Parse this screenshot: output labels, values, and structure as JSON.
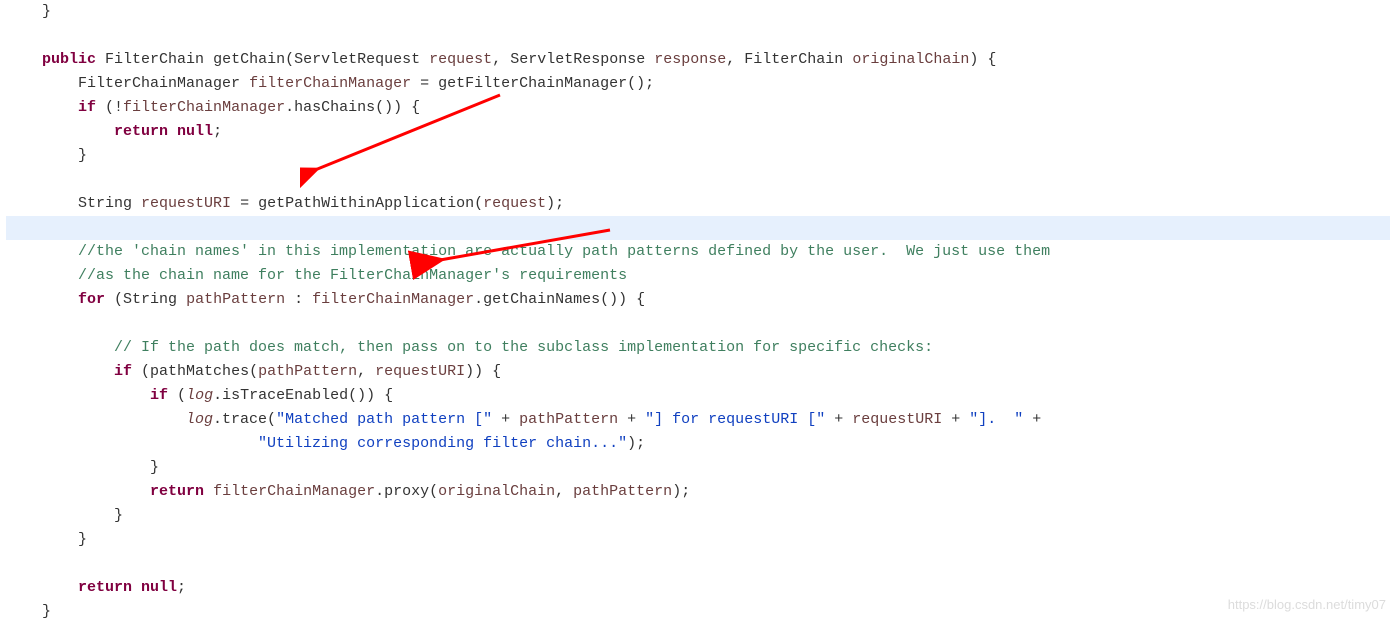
{
  "watermark": "https://blog.csdn.net/timy07",
  "colors": {
    "keyword": "#800040",
    "comment": "#3f7f5f",
    "string": "#1040c0",
    "variable": "#6a3e3e",
    "highlight": "#e6f0fd",
    "arrow": "#ff0000"
  },
  "arrows": [
    {
      "from_approx": "right-of getFilterChainManager() line",
      "to_approx": "requestURI token"
    },
    {
      "from_approx": "right end of first comment line",
      "to_approx": "FilterChainManager word in second comment"
    }
  ],
  "code": {
    "lines": [
      {
        "n": 0,
        "raw": "}"
      },
      {
        "n": 1,
        "raw": ""
      },
      {
        "n": 2,
        "raw": "public FilterChain getChain(ServletRequest request, ServletResponse response, FilterChain originalChain) {"
      },
      {
        "n": 3,
        "raw": "    FilterChainManager filterChainManager = getFilterChainManager();"
      },
      {
        "n": 4,
        "raw": "    if (!filterChainManager.hasChains()) {"
      },
      {
        "n": 5,
        "raw": "        return null;"
      },
      {
        "n": 6,
        "raw": "    }"
      },
      {
        "n": 7,
        "raw": ""
      },
      {
        "n": 8,
        "raw": "    String requestURI = getPathWithinApplication(request);",
        "highlighted_next_blank": true
      },
      {
        "n": 9,
        "raw": "",
        "highlighted": true
      },
      {
        "n": 10,
        "raw": "    //the 'chain names' in this implementation are actually path patterns defined by the user.  We just use them"
      },
      {
        "n": 11,
        "raw": "    //as the chain name for the FilterChainManager's requirements"
      },
      {
        "n": 12,
        "raw": "    for (String pathPattern : filterChainManager.getChainNames()) {"
      },
      {
        "n": 13,
        "raw": ""
      },
      {
        "n": 14,
        "raw": "        // If the path does match, then pass on to the subclass implementation for specific checks:"
      },
      {
        "n": 15,
        "raw": "        if (pathMatches(pathPattern, requestURI)) {"
      },
      {
        "n": 16,
        "raw": "            if (log.isTraceEnabled()) {"
      },
      {
        "n": 17,
        "raw": "                log.trace(\"Matched path pattern [\" + pathPattern + \"] for requestURI [\" + requestURI + \"].  \" +"
      },
      {
        "n": 18,
        "raw": "                        \"Utilizing corresponding filter chain...\");"
      },
      {
        "n": 19,
        "raw": "            }"
      },
      {
        "n": 20,
        "raw": "            return filterChainManager.proxy(originalChain, pathPattern);"
      },
      {
        "n": 21,
        "raw": "        }"
      },
      {
        "n": 22,
        "raw": "    }"
      },
      {
        "n": 23,
        "raw": ""
      },
      {
        "n": 24,
        "raw": "    return null;"
      },
      {
        "n": 25,
        "raw": "}"
      }
    ]
  }
}
